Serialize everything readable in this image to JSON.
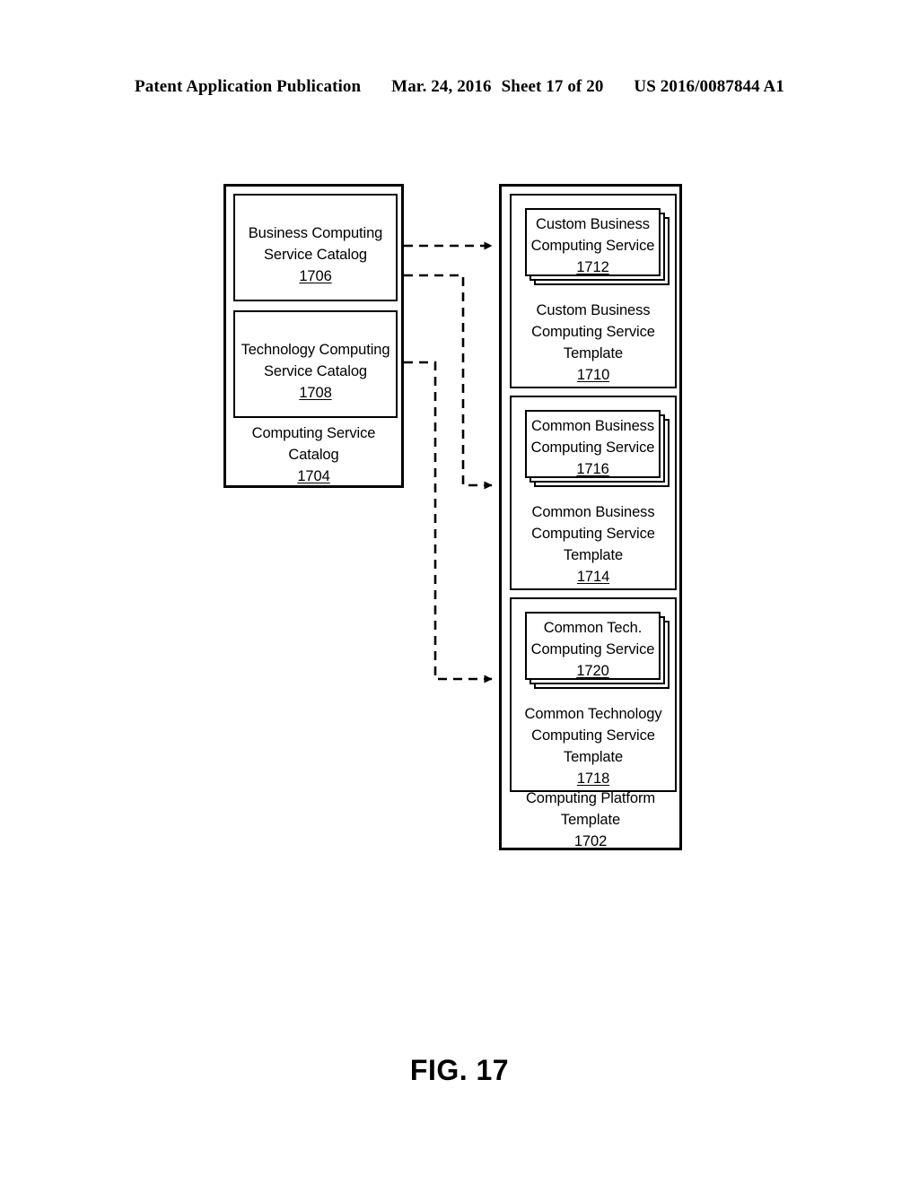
{
  "header": {
    "publication": "Patent Application Publication",
    "date": "Mar. 24, 2016",
    "sheet": "Sheet 17 of 20",
    "patent_number": "US 2016/0087844 A1"
  },
  "figure": {
    "caption": "FIG. 17",
    "left_container": {
      "label_line1": "Computing Service",
      "label_line2": "Catalog",
      "ref": "1704",
      "boxes": [
        {
          "name": "business-computing-service-catalog",
          "line1": "Business Computing",
          "line2": "Service Catalog",
          "ref": "1706"
        },
        {
          "name": "technology-computing-service-catalog",
          "line1": "Technology Computing",
          "line2": "Service Catalog",
          "ref": "1708"
        }
      ]
    },
    "right_container": {
      "label_line1": "Computing Platform",
      "label_line2": "Template",
      "ref": "1702",
      "templates": [
        {
          "name": "custom-business-computing-service-template",
          "card_line1": "Custom Business",
          "card_line2": "Computing Service",
          "card_ref": "1712",
          "label_line1": "Custom Business",
          "label_line2": "Computing Service",
          "label_line3": "Template",
          "ref": "1710"
        },
        {
          "name": "common-business-computing-service-template",
          "card_line1": "Common Business",
          "card_line2": "Computing Service",
          "card_ref": "1716",
          "label_line1": "Common Business",
          "label_line2": "Computing Service",
          "label_line3": "Template",
          "ref": "1714"
        },
        {
          "name": "common-technology-computing-service-template",
          "card_line1": "Common Tech.",
          "card_line2": "Computing Service",
          "card_ref": "1720",
          "label_line1": "Common Technology",
          "label_line2": "Computing Service",
          "label_line3": "Template",
          "ref": "1718"
        }
      ]
    },
    "connectors": [
      {
        "name": "connector-1706-to-1710",
        "from": "1706",
        "to": "1710",
        "style": "dashed-arrow"
      },
      {
        "name": "connector-1706-to-1714",
        "from": "1706",
        "to": "1714",
        "style": "dashed-arrow"
      },
      {
        "name": "connector-1708-to-1718",
        "from": "1708",
        "to": "1718",
        "style": "dashed-arrow"
      }
    ],
    "colors": {
      "line": "#000000",
      "background": "#ffffff"
    }
  }
}
